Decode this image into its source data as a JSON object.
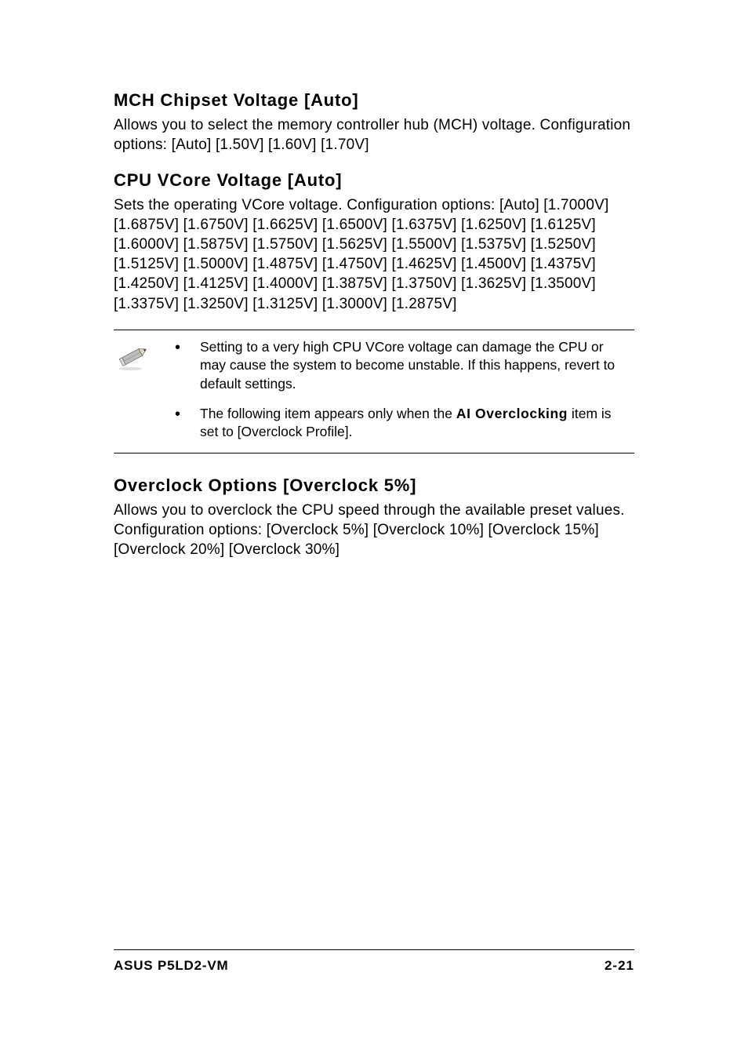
{
  "sections": {
    "mch": {
      "heading": "MCH Chipset Voltage [Auto]",
      "body": "Allows you to select the memory controller hub (MCH) voltage. Configuration options: [Auto] [1.50V] [1.60V] [1.70V]"
    },
    "vcore": {
      "heading": "CPU VCore Voltage [Auto]",
      "body": "Sets the operating VCore voltage. Configuration options: [Auto] [1.7000V] [1.6875V] [1.6750V] [1.6625V] [1.6500V] [1.6375V] [1.6250V] [1.6125V] [1.6000V] [1.5875V] [1.5750V] [1.5625V] [1.5500V] [1.5375V] [1.5250V] [1.5125V] [1.5000V] [1.4875V] [1.4750V] [1.4625V] [1.4500V] [1.4375V] [1.4250V] [1.4125V] [1.4000V] [1.3875V] [1.3750V] [1.3625V] [1.3500V] [1.3375V] [1.3250V] [1.3125V] [1.3000V] [1.2875V]"
    },
    "overclock": {
      "heading": "Overclock Options [Overclock 5%]",
      "body": "Allows you to overclock the CPU speed through the available preset values. Configuration options:  [Overclock 5%] [Overclock 10%] [Overclock 15%] [Overclock 20%] [Overclock 30%]"
    }
  },
  "notes": {
    "item1": "Setting to a very high CPU VCore voltage can damage the CPU or may cause the system to become unstable. If this happens, revert to default settings.",
    "item2_pre": "The following item appears only when the ",
    "item2_bold": "AI Overclocking",
    "item2_post": " item is set to [Overclock Profile]."
  },
  "footer": {
    "left": "ASUS P5LD2-VM",
    "right": "2-21"
  },
  "bullet_glyph": "•"
}
